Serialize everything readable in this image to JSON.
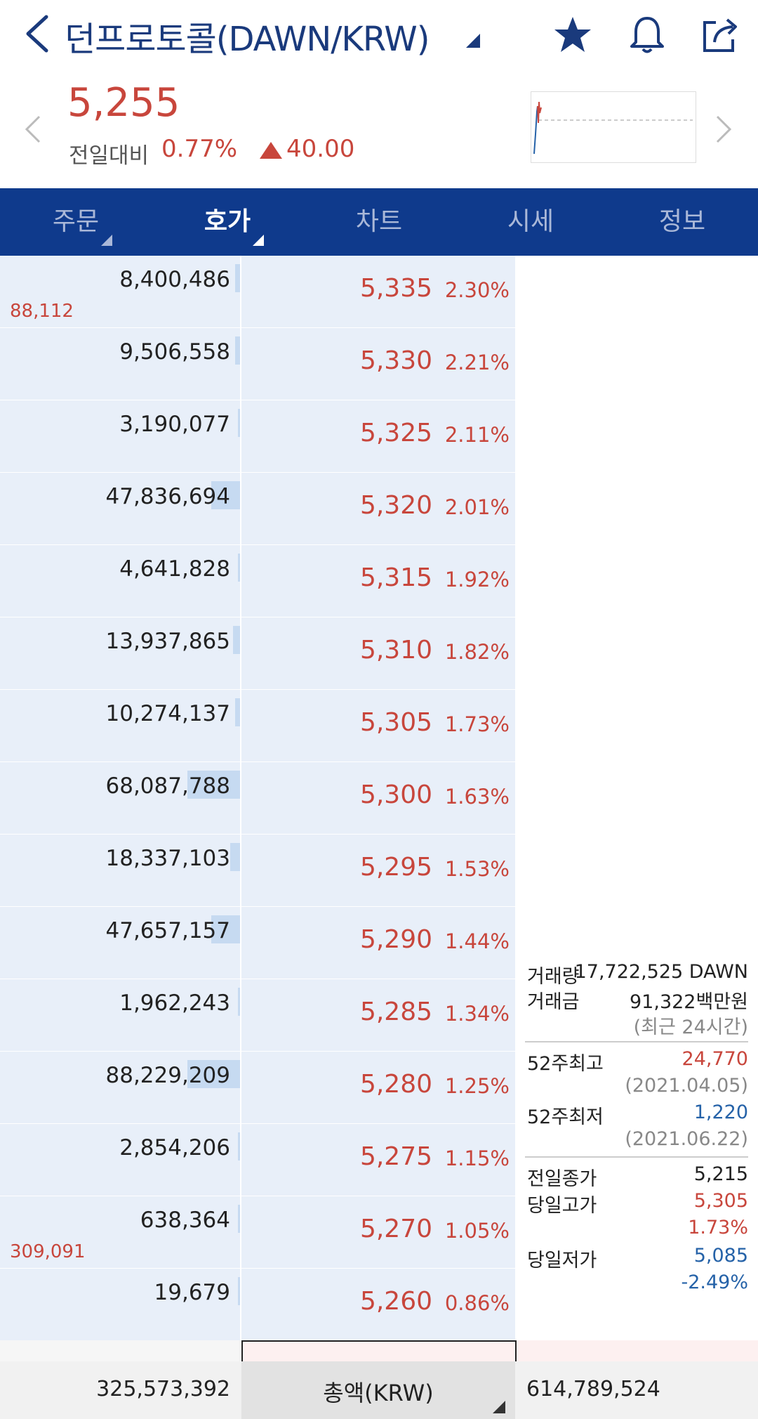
{
  "header": {
    "title": "던프로토콜(DAWN/KRW)"
  },
  "price": {
    "current": "5,255",
    "change_label": "전일대비",
    "change_pct": "0.77%",
    "change_abs": "40.00"
  },
  "tabs": [
    {
      "label": "주문"
    },
    {
      "label": "호가"
    },
    {
      "label": "차트"
    },
    {
      "label": "시세"
    },
    {
      "label": "정보"
    }
  ],
  "orderbook": {
    "rows": [
      {
        "qty": "8,400,486",
        "sub": "88,112",
        "price": "5,335",
        "pct": "2.30%",
        "bar": 0.02
      },
      {
        "qty": "9,506,558",
        "sub": "",
        "price": "5,330",
        "pct": "2.21%",
        "bar": 0.02
      },
      {
        "qty": "3,190,077",
        "sub": "",
        "price": "5,325",
        "pct": "2.11%",
        "bar": 0.01
      },
      {
        "qty": "47,836,694",
        "sub": "",
        "price": "5,320",
        "pct": "2.01%",
        "bar": 0.12
      },
      {
        "qty": "4,641,828",
        "sub": "",
        "price": "5,315",
        "pct": "1.92%",
        "bar": 0.01
      },
      {
        "qty": "13,937,865",
        "sub": "",
        "price": "5,310",
        "pct": "1.82%",
        "bar": 0.03
      },
      {
        "qty": "10,274,137",
        "sub": "",
        "price": "5,305",
        "pct": "1.73%",
        "bar": 0.02
      },
      {
        "qty": "68,087,788",
        "sub": "",
        "price": "5,300",
        "pct": "1.63%",
        "bar": 0.22
      },
      {
        "qty": "18,337,103",
        "sub": "",
        "price": "5,295",
        "pct": "1.53%",
        "bar": 0.04
      },
      {
        "qty": "47,657,157",
        "sub": "",
        "price": "5,290",
        "pct": "1.44%",
        "bar": 0.12
      },
      {
        "qty": "1,962,243",
        "sub": "",
        "price": "5,285",
        "pct": "1.34%",
        "bar": 0.005
      },
      {
        "qty": "88,229,209",
        "sub": "",
        "price": "5,280",
        "pct": "1.25%",
        "bar": 0.22
      },
      {
        "qty": "2,854,206",
        "sub": "",
        "price": "5,275",
        "pct": "1.15%",
        "bar": 0.005
      },
      {
        "qty": "638,364",
        "sub": "309,091",
        "price": "5,270",
        "pct": "1.05%",
        "bar": 0.0
      },
      {
        "qty": "19,679",
        "sub": "",
        "price": "5,260",
        "pct": "0.86%",
        "bar": 0.0
      }
    ]
  },
  "info": {
    "volume_label": "거래량",
    "volume_value": "17,722,525 DAWN",
    "amount_label": "거래금",
    "amount_value": "91,322백만원",
    "recent": "(최근 24시간)",
    "high52_label": "52주최고",
    "high52_value": "24,770",
    "high52_date": "(2021.04.05)",
    "low52_label": "52주최저",
    "low52_value": "1,220",
    "low52_date": "(2021.06.22)",
    "prev_close_label": "전일종가",
    "prev_close_value": "5,215",
    "day_high_label": "당일고가",
    "day_high_value": "5,305",
    "day_high_pct": "1.73%",
    "day_low_label": "당일저가",
    "day_low_value": "5,085",
    "day_low_pct": "-2.49%"
  },
  "footer": {
    "sell_total": "325,573,392",
    "mode_label": "총액(KRW)",
    "buy_total": "614,789,524"
  },
  "colors": {
    "up": "#c8463c",
    "down": "#2562a8",
    "tabbar": "#0f3a8c",
    "title": "#1a3a7c"
  }
}
